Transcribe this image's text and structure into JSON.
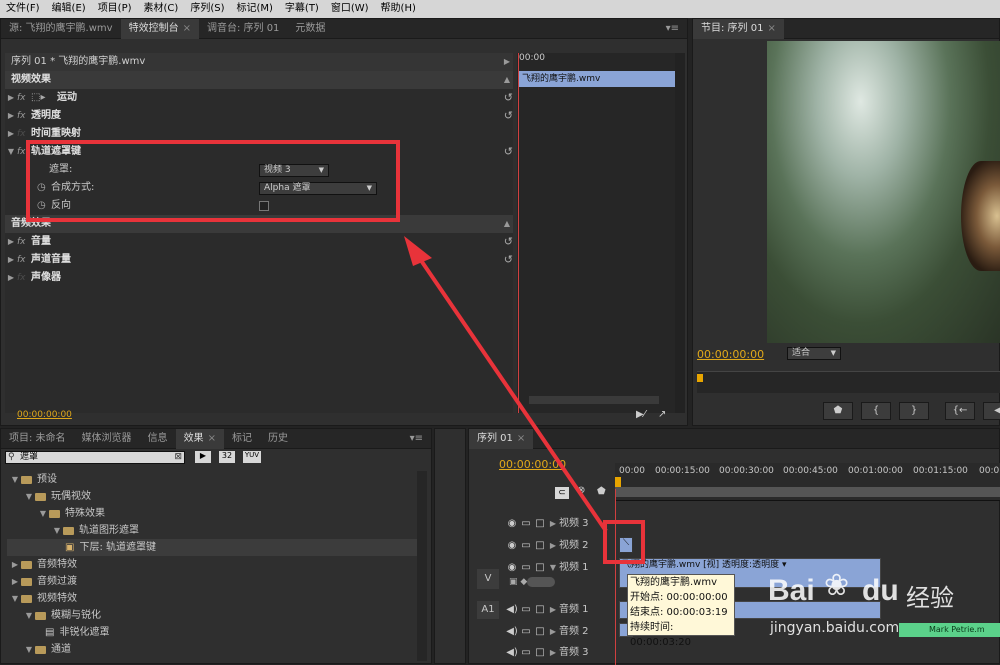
{
  "menu": [
    "文件(F)",
    "编辑(E)",
    "项目(P)",
    "素材(C)",
    "序列(S)",
    "标记(M)",
    "字幕(T)",
    "窗口(W)",
    "帮助(H)"
  ],
  "top_tabs": {
    "source": "源: 飞翔的鹰宇鹏.wmv",
    "effect_controls": "特效控制台",
    "mixer": "调音台: 序列 01",
    "metadata": "元数据"
  },
  "ec": {
    "header": "序列 01 * 飞翔的鹰宇鹏.wmv",
    "time_mark": "00:00",
    "clip_label": "飞翔的鹰宇鹏.wmv",
    "video_effects": "视频效果",
    "motion": "运动",
    "opacity": "透明度",
    "time_remap": "时间重映射",
    "track_matte": "轨道遮罩键",
    "matte_label": "遮罩:",
    "matte_value": "视频 3",
    "composite_label": "合成方式:",
    "composite_value": "Alpha 遮罩",
    "reverse_label": "反向",
    "audio_effects": "音频效果",
    "volume": "音量",
    "channel_volume": "声道音量",
    "panner": "声像器",
    "timecode": "00:00:00:00"
  },
  "program": {
    "tab": "节目: 序列 01",
    "timecode": "00:00:00:00",
    "fit": "适合"
  },
  "project_tabs": [
    "项目: 未命名",
    "媒体浏览器",
    "信息",
    "效果",
    "标记",
    "历史"
  ],
  "search": {
    "value": "遮罩",
    "b1": "32",
    "b2": "YUV"
  },
  "effects_tree": [
    "预设",
    "玩偶视效",
    "特殊效果",
    "轨道图形遮罩",
    "下层: 轨道遮罩键",
    "音频特效",
    "音频过渡",
    "视频特效",
    "模糊与锐化",
    "非锐化遮罩",
    "通道"
  ],
  "timeline": {
    "tab": "序列 01",
    "timecode": "00:00:00:00",
    "ruler": [
      "00:00",
      "00:00:15:00",
      "00:00:30:00",
      "00:00:45:00",
      "00:01:00:00",
      "00:01:15:00",
      "00:01:30:00"
    ],
    "tracks": {
      "v3": "视频 3",
      "v2": "视频 2",
      "v1": "视频 1",
      "a1": "音频 1",
      "a2": "音频 2",
      "a3": "音频 3",
      "v_target": "V",
      "a_target": "A1"
    },
    "clip_label": "飞翔的鹰宇鹏.wmv [视] 透明度:透明度 ▾",
    "audio_clip": "Mark Petrie.m",
    "tooltip": {
      "name": "飞翔的鹰宇鹏.wmv",
      "start": "开始点: 00:00:00:00",
      "end": "结束点: 00:00:03:19",
      "duration": "持续时间: 00:00:03:20"
    }
  },
  "watermark": {
    "brand": "Bai",
    "brand2": "du",
    "cn": "经验",
    "url": "jingyan.baidu.com"
  },
  "colors": {
    "accent": "#e8a500",
    "timecode": "#e0a81a",
    "annotation": "#e8333a",
    "clip": "#8aa4d6"
  }
}
